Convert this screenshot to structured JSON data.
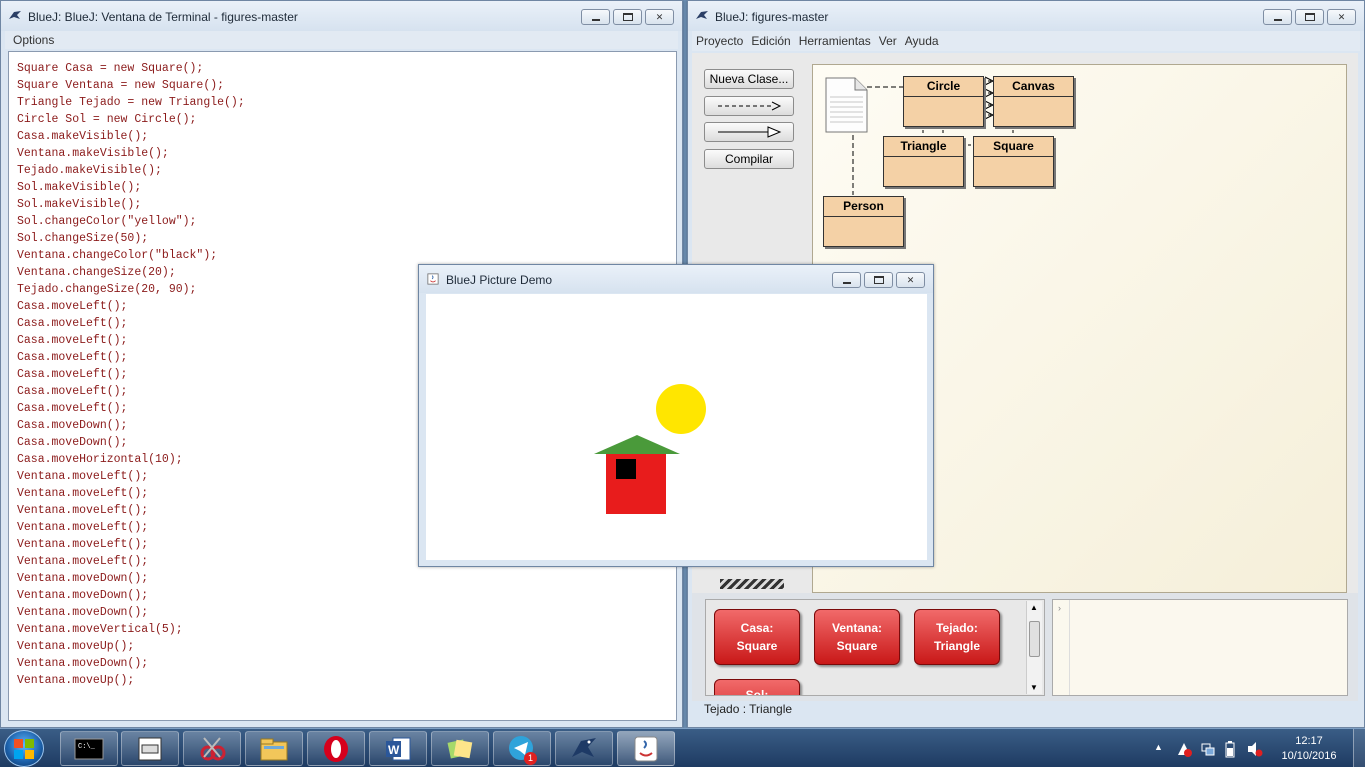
{
  "terminal": {
    "title": "BlueJ: BlueJ:  Ventana de Terminal - figures-master",
    "menu_options": "Options",
    "lines": [
      "Square Casa = new Square();",
      "Square Ventana = new Square();",
      "Triangle Tejado = new Triangle();",
      "Circle Sol = new Circle();",
      "Casa.makeVisible();",
      "Ventana.makeVisible();",
      "Tejado.makeVisible();",
      "Sol.makeVisible();",
      "Sol.makeVisible();",
      "Sol.changeColor(\"yellow\");",
      "Sol.changeSize(50);",
      "Ventana.changeColor(\"black\");",
      "Ventana.changeSize(20);",
      "Tejado.changeSize(20, 90);",
      "Casa.moveLeft();",
      "Casa.moveLeft();",
      "Casa.moveLeft();",
      "Casa.moveLeft();",
      "Casa.moveLeft();",
      "Casa.moveLeft();",
      "Casa.moveLeft();",
      "Casa.moveDown();",
      "Casa.moveDown();",
      "Casa.moveHorizontal(10);",
      "Ventana.moveLeft();",
      "Ventana.moveLeft();",
      "Ventana.moveLeft();",
      "Ventana.moveLeft();",
      "Ventana.moveLeft();",
      "Ventana.moveLeft();",
      "Ventana.moveDown();",
      "Ventana.moveDown();",
      "Ventana.moveDown();",
      "Ventana.moveVertical(5);",
      "Ventana.moveUp();",
      "Ventana.moveDown();",
      "Ventana.moveUp();"
    ]
  },
  "project": {
    "title": "BlueJ:  figures-master",
    "menu": [
      "Proyecto",
      "Edición",
      "Herramientas",
      "Ver",
      "Ayuda"
    ],
    "buttons": {
      "new_class": "Nueva Clase...",
      "compile": "Compilar"
    },
    "classes": [
      "Circle",
      "Canvas",
      "Triangle",
      "Square",
      "Person"
    ],
    "objects": [
      {
        "name": "Casa:",
        "type": "Square"
      },
      {
        "name": "Ventana:",
        "type": "Square"
      },
      {
        "name": "Tejado:",
        "type": "Triangle"
      },
      {
        "name": "Sol:",
        "type": ""
      }
    ],
    "status": "Tejado : Triangle"
  },
  "picture_demo": {
    "title": "BlueJ Picture Demo",
    "colors": {
      "sun": "#ffe600",
      "roof": "#4a9a3a",
      "house": "#e81c1c",
      "window": "#000000"
    }
  },
  "taskbar": {
    "apps": [
      "cmd-icon",
      "bluej-terminal-icon",
      "snipping-tool-icon",
      "file-explorer-icon",
      "opera-icon",
      "word-icon",
      "sticky-notes-icon",
      "telegram-icon",
      "bluej-icon",
      "java-icon"
    ],
    "telegram_badge": "1",
    "time": "12:17",
    "date": "10/10/2016"
  }
}
